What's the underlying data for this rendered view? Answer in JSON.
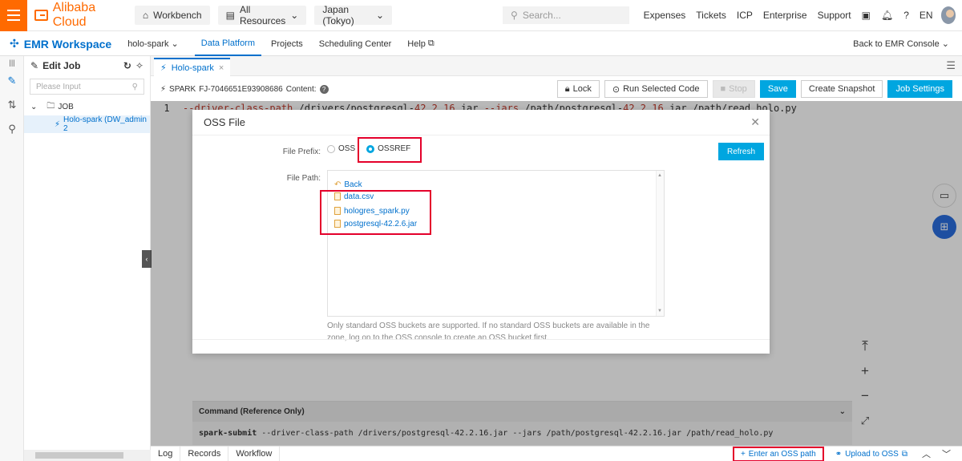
{
  "topbar": {
    "brand": "Alibaba Cloud",
    "workbench": "Workbench",
    "all_resources": "All Resources",
    "region": "Japan (Tokyo)",
    "search_placeholder": "Search...",
    "links": [
      "Expenses",
      "Tickets",
      "ICP",
      "Enterprise",
      "Support"
    ],
    "lang": "EN",
    "accent": "#ff6a00"
  },
  "navbar": {
    "title": "EMR Workspace",
    "project": "holo-spark",
    "items": [
      "Data Platform",
      "Projects",
      "Scheduling Center",
      "Help"
    ],
    "back": "Back to EMR Console"
  },
  "tree": {
    "title": "Edit Job",
    "search_placeholder": "Please Input",
    "folder": "JOB",
    "job": "Holo-spark (DW_admin 2"
  },
  "editor": {
    "tab": "Holo-spark",
    "job_type": "SPARK",
    "job_id": "FJ-7046651E93908686",
    "content_label": "Content:",
    "buttons": {
      "lock": "Lock",
      "run": "Run Selected Code",
      "stop": "Stop",
      "save": "Save",
      "snapshot": "Create Snapshot",
      "settings": "Job Settings"
    },
    "line_number": "1",
    "code_a": "--driver-class-path ",
    "code_b": "/drivers/postgresql-",
    "code_c": "42.2.16",
    "code_d": ".jar  ",
    "code_e": "--jars",
    "code_f": "  /path/postgresql-",
    "code_g": "42.2.16",
    "code_h": ".jar   /path/read_holo.py"
  },
  "modal": {
    "title": "OSS File",
    "prefix_label": "File Prefix:",
    "opt_oss": "OSS",
    "opt_ossref": "OSSREF",
    "refresh": "Refresh",
    "path_label": "File Path:",
    "back": "Back",
    "files": [
      "data.csv",
      "hologres_spark.py",
      "postgresql-42.2.6.jar"
    ],
    "hint": "Only standard OSS buckets are supported. If no standard OSS buckets are available in the zone, log on to the OSS console to create an OSS bucket first."
  },
  "command": {
    "title": "Command (Reference Only)",
    "cmd_bold": "spark-submit",
    "cmd_rest": " --driver-class-path /drivers/postgresql-42.2.16.jar  --jars  /path/postgresql-42.2.16.jar   /path/read_holo.py"
  },
  "bottom": {
    "tabs": [
      "Log",
      "Records",
      "Workflow"
    ],
    "enter_oss": "Enter an OSS path",
    "upload": "Upload to OSS"
  }
}
